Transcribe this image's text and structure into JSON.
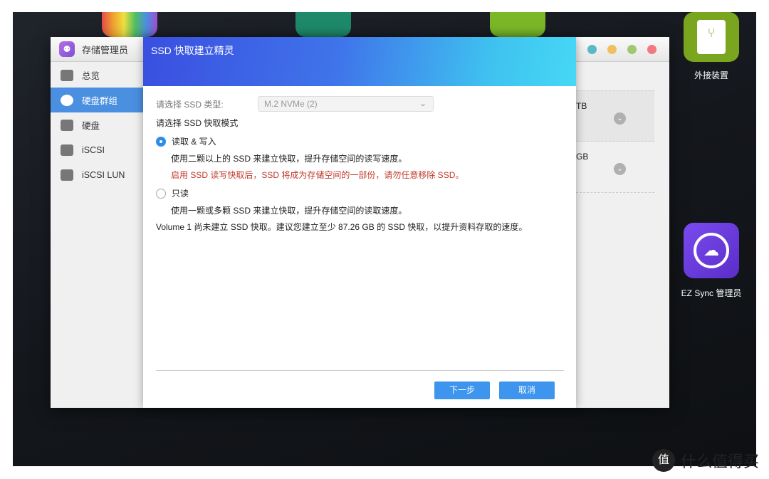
{
  "desktop": {
    "icons": [
      {
        "name": "external-device",
        "label": "外接装置",
        "color": "#7aa51e"
      },
      {
        "name": "ez-sync",
        "label": "EZ Sync 管理员",
        "color": "#6a3be0"
      }
    ]
  },
  "window": {
    "title": "存储管理员",
    "sidebar": [
      {
        "label": "总览",
        "icon": "list-icon"
      },
      {
        "label": "硬盘群组",
        "icon": "disk-group-icon",
        "active": true
      },
      {
        "label": "硬盘",
        "icon": "hdd-icon"
      },
      {
        "label": "iSCSI",
        "icon": "iscsi-icon"
      },
      {
        "label": "iSCSI LUN",
        "icon": "database-icon"
      }
    ],
    "right_rows": [
      "TB",
      "GB"
    ],
    "window_controls": [
      "#5bb8c4",
      "#f0c060",
      "#a0c870",
      "#f07a80"
    ]
  },
  "dialog": {
    "title": "SSD 快取建立精灵",
    "type_label": "请选择 SSD 类型:",
    "type_value": "M.2 NVMe (2)",
    "mode_label": "请选择 SSD 快取模式",
    "option_rw": "读取 & 写入",
    "option_rw_desc": "使用二颗以上的 SSD 来建立快取，提升存储空间的读写速度。",
    "option_rw_warn": "启用 SSD 读写快取后，SSD 将成为存储空间的一部份，请勿任意移除 SSD。",
    "option_ro": "只读",
    "option_ro_desc": "使用一颗或多颗 SSD 来建立快取，提升存储空间的读取速度。",
    "note": "Volume 1 尚未建立 SSD 快取。建议您建立至少 87.26 GB 的 SSD 快取，以提升资料存取的速度。",
    "selected_mode": "读取 & 写入",
    "next": "下一步",
    "cancel": "取消"
  },
  "watermark": {
    "logo": "值",
    "text": "什么值得买"
  }
}
